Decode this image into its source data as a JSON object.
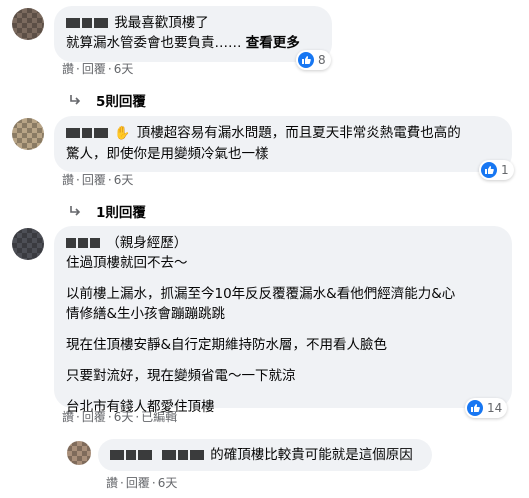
{
  "comments": [
    {
      "text_lines": [
        "我最喜歡頂樓了",
        "就算漏水管委會也要負責……"
      ],
      "see_more": "查看更多",
      "reactions": "8",
      "actions": {
        "like": "讚",
        "reply": "回覆",
        "time": "6天"
      },
      "replies_label": "5則回覆"
    },
    {
      "text_lines": [
        "頂樓超容易有漏水問題，而且夏天非常炎熱電費也高的",
        "驚人，即使你是用變頻冷氣也一樣"
      ],
      "reactions": "1",
      "actions": {
        "like": "讚",
        "reply": "回覆",
        "time": "6天"
      },
      "replies_label": "1則回覆"
    },
    {
      "header_suffix": "（親身經歷）",
      "first_line": "住過頂樓就回不去～",
      "paragraphs": [
        [
          "以前樓上漏水，抓漏至今10年反反覆覆漏水&看他們經濟能力&心",
          "情修繕&生小孩會蹦蹦跳跳"
        ],
        [
          "現在住頂樓安靜&自行定期維持防水層，不用看人臉色"
        ],
        [
          "只要對流好，現在變頻省電～一下就涼"
        ],
        [
          "台北市有錢人都愛住頂樓"
        ]
      ],
      "reactions": "14",
      "actions": {
        "like": "讚",
        "reply": "回覆",
        "time": "6天",
        "edited": "已編輯"
      }
    },
    {
      "text": "的確頂樓比較貴可能就是這個原因",
      "actions": {
        "like": "讚",
        "reply": "回覆",
        "time": "6天"
      }
    }
  ],
  "colors": {
    "like_blue": "#1877f2",
    "bubble_bg": "#f0f2f5",
    "meta_gray": "#65676b"
  }
}
